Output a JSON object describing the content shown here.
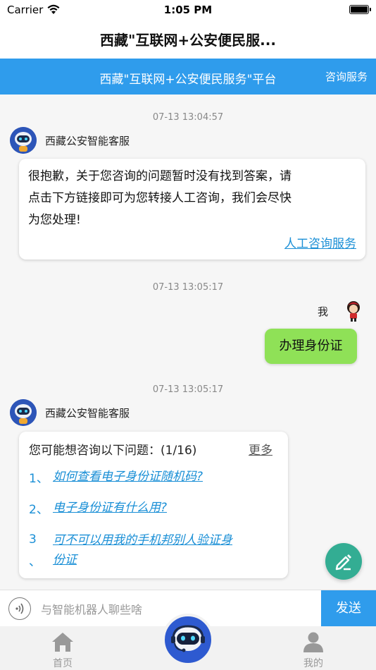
{
  "status_bar": {
    "carrier": "Carrier",
    "time": "1:05 PM"
  },
  "nav": {
    "title": "西藏\"互联网+公安便民服..."
  },
  "banner": {
    "title": "西藏\"互联网+公安便民服务\"平台",
    "service": "咨询服务"
  },
  "messages": [
    {
      "timestamp": "07-13 13:04:57",
      "sender": "西藏公安智能客服",
      "lines": [
        "很抱歉，关于您咨询的问题暂时没有找到答案，请",
        "点击下方链接即可为您转接人工咨询，我们会尽快",
        "为您处理!"
      ],
      "link": "人工咨询服务"
    },
    {
      "timestamp": "07-13 13:05:17",
      "sender": "我",
      "text": "办理身份证"
    },
    {
      "timestamp": "07-13 13:05:17",
      "sender": "西藏公安智能客服",
      "header": "您可能想咨询以下问题：(1/16)",
      "more": "更多",
      "suggestions": [
        {
          "num": "1、",
          "text": "如何查看电子身份证随机码?"
        },
        {
          "num": "2、",
          "text": "电子身份证有什么用?"
        },
        {
          "num": "3",
          "num_extra": "、",
          "lines": [
            "可不可以用我的手机邦别人验证身",
            "份证"
          ]
        }
      ]
    }
  ],
  "input": {
    "placeholder": "与智能机器人聊些啥",
    "send": "发送"
  },
  "tabs": {
    "home": "首页",
    "mine": "我的"
  },
  "colors": {
    "accent": "#2f9cec",
    "user_bubble": "#8fe157",
    "fab": "#33ad93",
    "link": "#1a8fd6"
  }
}
